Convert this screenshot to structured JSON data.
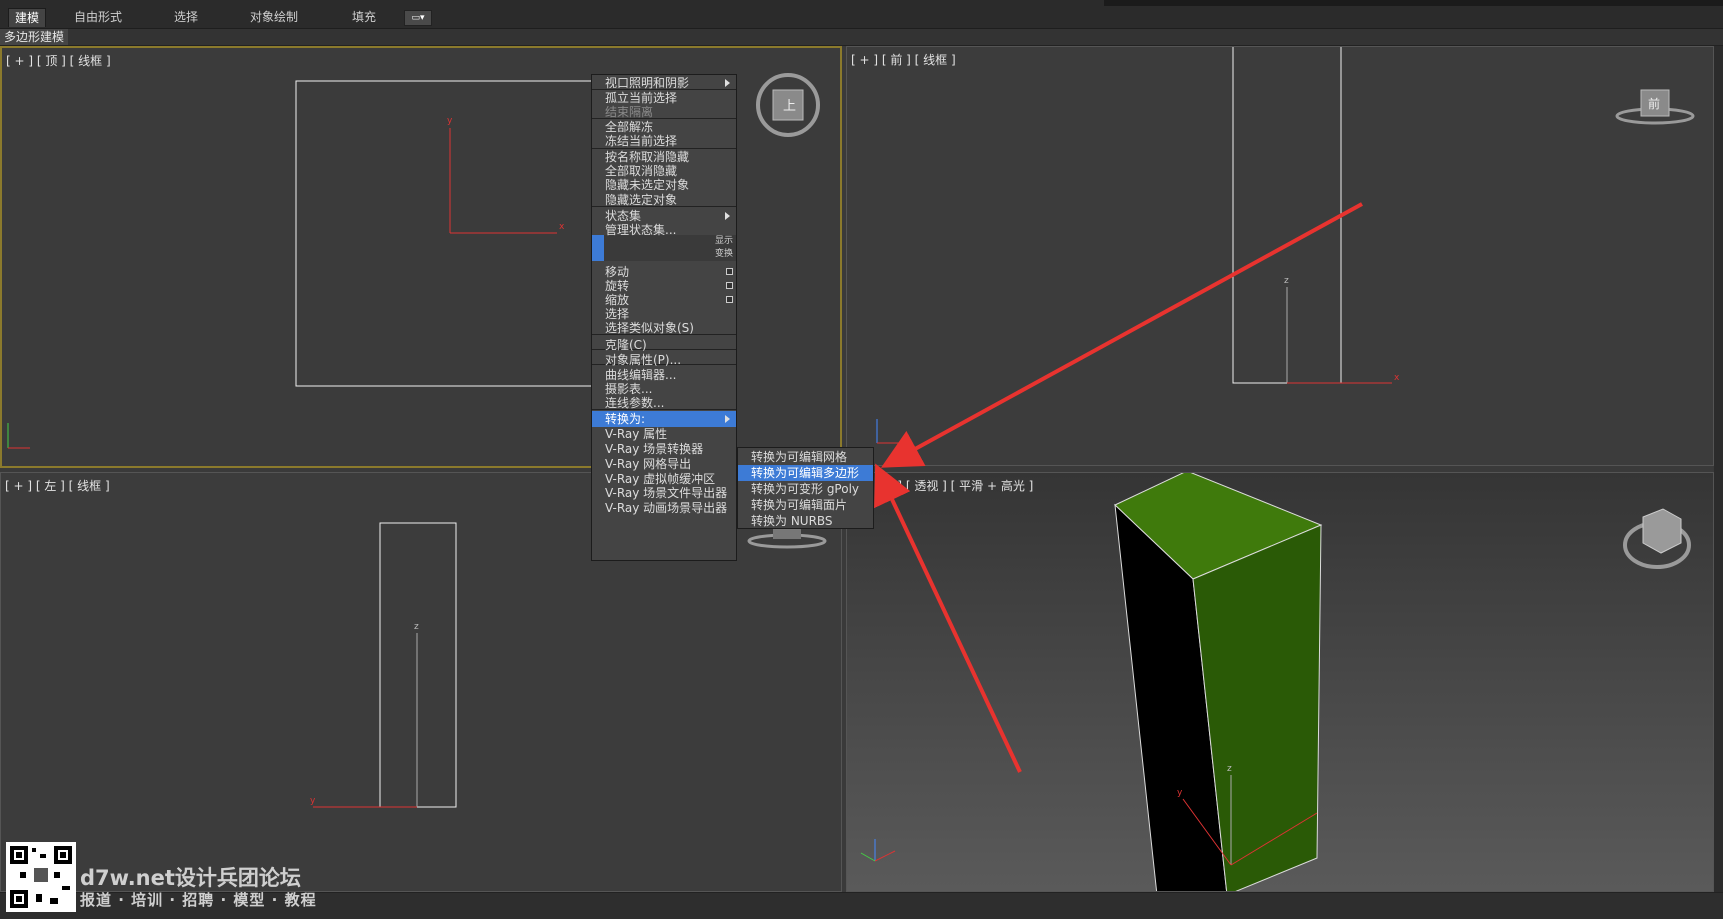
{
  "ribbon": {
    "tabs": [
      "建模",
      "自由形式",
      "选择",
      "对象绘制",
      "填充"
    ],
    "active_tab": "建模",
    "subtab": "多边形建模"
  },
  "viewports": {
    "top": "[ + ] [ 顶 ] [ 线框 ]",
    "front": "[ + ] [ 前 ] [ 线框 ]",
    "left": "[ + ] [ 左 ] [ 线框 ]",
    "perspective": "[ + ] [ 透视 ] [ 平滑 + 高光 ]",
    "top_cube_label": "上",
    "front_cube_label": "前",
    "axes": {
      "x": "x",
      "y": "y",
      "z": "z"
    }
  },
  "quad_menu": {
    "items": [
      {
        "label": "视口照明和阴影",
        "arrow": true
      },
      {
        "label": "孤立当前选择"
      },
      {
        "label": "结束隔离",
        "disabled": true
      },
      {
        "label": "全部解冻"
      },
      {
        "label": "冻结当前选择"
      },
      {
        "label": "按名称取消隐藏"
      },
      {
        "label": "全部取消隐藏"
      },
      {
        "label": "隐藏未选定对象"
      },
      {
        "label": "隐藏选定对象"
      },
      {
        "label": "状态集",
        "arrow": true
      },
      {
        "label": "管理状态集..."
      },
      {
        "label": "移动",
        "box": true
      },
      {
        "label": "旋转",
        "box": true
      },
      {
        "label": "缩放",
        "box": true
      },
      {
        "label": "选择"
      },
      {
        "label": "选择类似对象(S)"
      },
      {
        "label": "克隆(C)"
      },
      {
        "label": "对象属性(P)..."
      },
      {
        "label": "曲线编辑器..."
      },
      {
        "label": "摄影表..."
      },
      {
        "label": "连线参数..."
      },
      {
        "label": "转换为:",
        "arrow": true,
        "highlighted": true
      },
      {
        "label": "V-Ray 属性"
      },
      {
        "label": "V-Ray 场景转换器"
      },
      {
        "label": "V-Ray 网格导出"
      },
      {
        "label": "V-Ray 虚拟帧缓冲区"
      },
      {
        "label": "V-Ray 场景文件导出器"
      },
      {
        "label": "V-Ray 动画场景导出器"
      }
    ],
    "header_display": "显示",
    "header_transform": "变换"
  },
  "submenu": {
    "items": [
      {
        "label": "转换为可编辑网格"
      },
      {
        "label": "转换为可编辑多边形",
        "highlighted": true
      },
      {
        "label": "转换为可变形 gPoly"
      },
      {
        "label": "转换为可编辑面片"
      },
      {
        "label": "转换为 NURBS"
      }
    ]
  },
  "watermark": {
    "title": "d7w.net设计兵团论坛",
    "subtitle": "报道 · 培训 · 招聘 · 模型 · 教程"
  },
  "colors": {
    "highlight": "#3d7bd6",
    "active_viewport_border": "#8b7a2c",
    "arrow": "#e8332f",
    "box_green": "#3f7a0c"
  }
}
